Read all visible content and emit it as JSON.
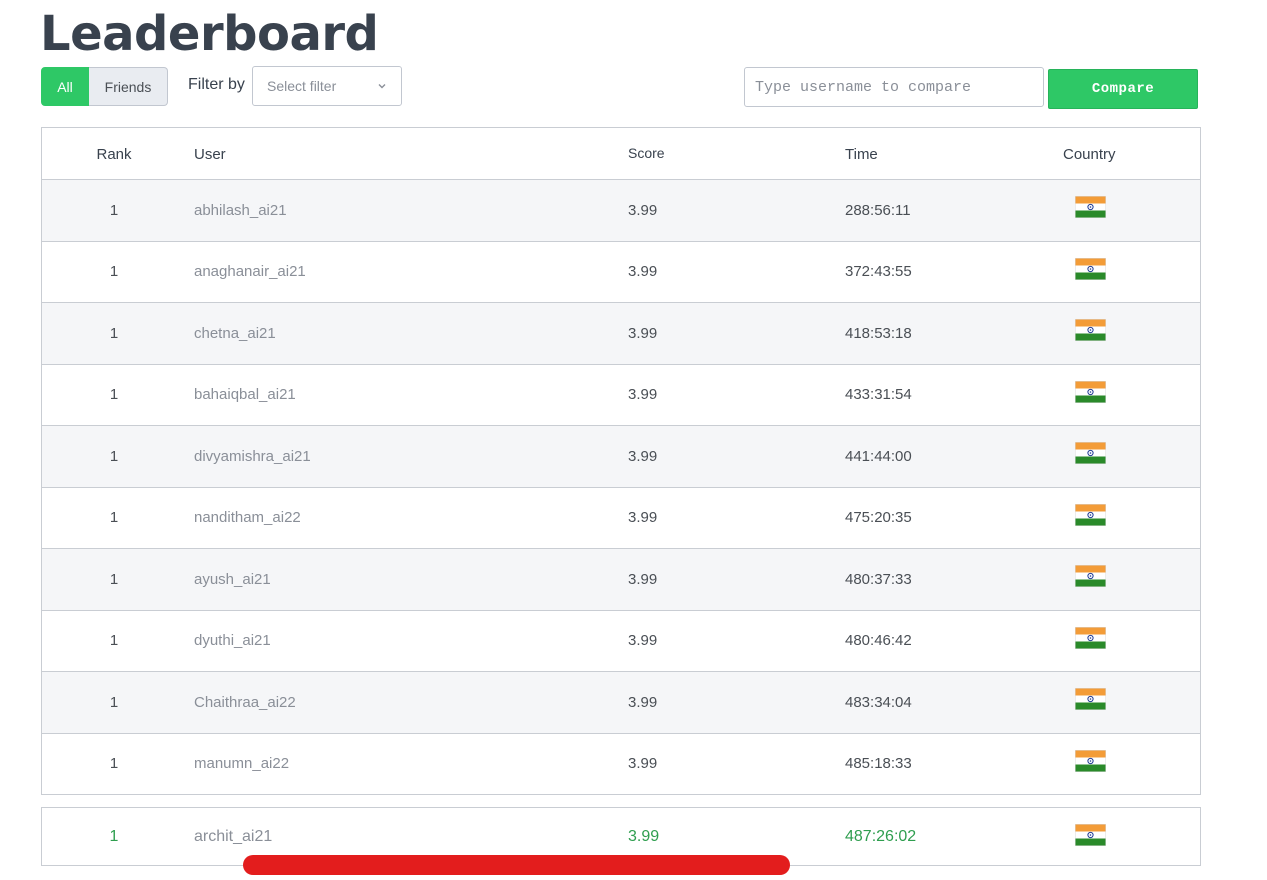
{
  "page": {
    "title": "Leaderboard"
  },
  "toolbar": {
    "tab_all": "All",
    "tab_friends": "Friends",
    "filter_label": "Filter by",
    "filter_placeholder": "Select filter",
    "compare_placeholder": "Type username to compare",
    "compare_label": "Compare"
  },
  "colors": {
    "accent": "#2ec866",
    "highlight_text": "#2f9e4f",
    "annotation": "#e31d1d"
  },
  "table": {
    "headers": {
      "rank": "Rank",
      "user": "User",
      "score": "Score",
      "time": "Time",
      "country": "Country"
    },
    "rows": [
      {
        "rank": "1",
        "user": "abhilash_ai21",
        "score": "3.99",
        "time": "288:56:11",
        "country": "india-flag"
      },
      {
        "rank": "1",
        "user": "anaghanair_ai21",
        "score": "3.99",
        "time": "372:43:55",
        "country": "india-flag"
      },
      {
        "rank": "1",
        "user": "chetna_ai21",
        "score": "3.99",
        "time": "418:53:18",
        "country": "india-flag"
      },
      {
        "rank": "1",
        "user": "bahaiqbal_ai21",
        "score": "3.99",
        "time": "433:31:54",
        "country": "india-flag"
      },
      {
        "rank": "1",
        "user": "divyamishra_ai21",
        "score": "3.99",
        "time": "441:44:00",
        "country": "india-flag"
      },
      {
        "rank": "1",
        "user": "nanditham_ai22",
        "score": "3.99",
        "time": "475:20:35",
        "country": "india-flag"
      },
      {
        "rank": "1",
        "user": "ayush_ai21",
        "score": "3.99",
        "time": "480:37:33",
        "country": "india-flag"
      },
      {
        "rank": "1",
        "user": "dyuthi_ai21",
        "score": "3.99",
        "time": "480:46:42",
        "country": "india-flag"
      },
      {
        "rank": "1",
        "user": "Chaithraa_ai22",
        "score": "3.99",
        "time": "483:34:04",
        "country": "india-flag"
      },
      {
        "rank": "1",
        "user": "manumn_ai22",
        "score": "3.99",
        "time": "485:18:33",
        "country": "india-flag"
      }
    ]
  },
  "current_user": {
    "rank": "1",
    "user": "archit_ai21",
    "score": "3.99",
    "time": "487:26:02",
    "country": "india-flag"
  }
}
